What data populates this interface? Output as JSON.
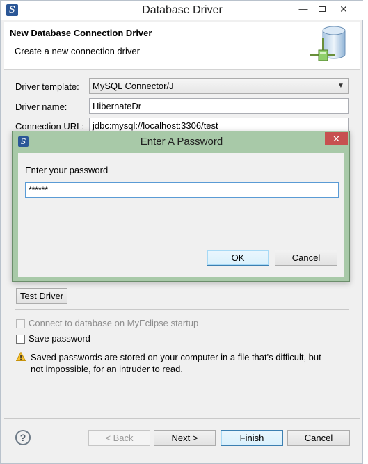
{
  "window": {
    "title": "Database Driver",
    "app_icon": "myeclipse-logo-icon",
    "minimize_glyph": "—",
    "close_glyph": "✕"
  },
  "banner": {
    "title": "New Database Connection Driver",
    "subtitle": "Create a new connection driver",
    "icon": "database-driver-icon"
  },
  "form": {
    "driver_template_label": "Driver template:",
    "driver_template_value": "MySQL Connector/J",
    "driver_name_label": "Driver name:",
    "driver_name_value": "HibernateDr",
    "connection_url_label": "Connection URL:",
    "connection_url_value": "jdbc:mysql://localhost:3306/test"
  },
  "test_driver_label": "Test Driver",
  "options": {
    "connect_on_startup_label": "Connect to database on MyEclipse startup",
    "connect_on_startup_checked": false,
    "connect_on_startup_enabled": false,
    "save_password_label": "Save password",
    "save_password_checked": false
  },
  "warning": {
    "icon": "warning-icon",
    "line1": "Saved passwords are stored on your computer in a file that's difficult, but",
    "line2": "not impossible, for an intruder to read."
  },
  "footer": {
    "help_glyph": "?",
    "back_label": "< Back",
    "next_label": "Next >",
    "finish_label": "Finish",
    "cancel_label": "Cancel"
  },
  "password_dialog": {
    "title": "Enter A Password",
    "prompt": "Enter your password",
    "password_value": "******",
    "ok_label": "OK",
    "cancel_label": "Cancel",
    "close_glyph": "✕"
  }
}
